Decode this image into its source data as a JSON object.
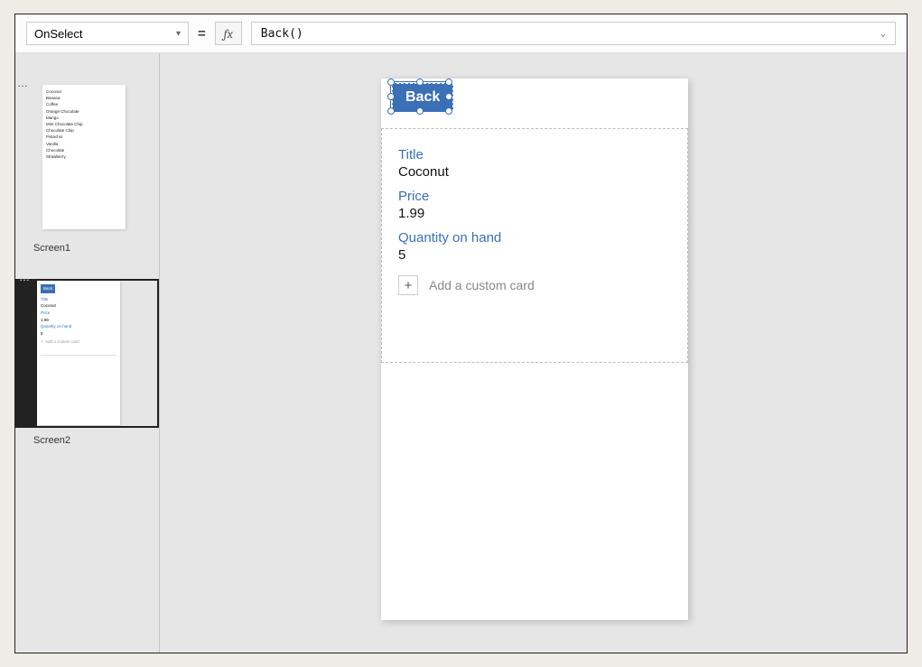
{
  "formula_bar": {
    "property": "OnSelect",
    "formula": "Back()"
  },
  "thumbs": {
    "screen1": {
      "label": "Screen1",
      "items": [
        "Coconut",
        "Banana",
        "Coffee",
        "Orange Chocolate",
        "Mango",
        "Mint Chocolate Chip",
        "Chocolate Chip",
        "Pistachio",
        "Vanilla",
        "Chocolate",
        "Strawberry"
      ]
    },
    "screen2": {
      "label": "Screen2",
      "back": "Back",
      "fields": {
        "title_label": "Title",
        "title_value": "Coconut",
        "price_label": "Price",
        "price_value": "1.99",
        "qty_label": "Quantity on hand",
        "qty_value": "5",
        "add": "Add a custom card"
      }
    }
  },
  "canvas": {
    "back_label": "Back",
    "fields": {
      "title_label": "Title",
      "title_value": "Coconut",
      "price_label": "Price",
      "price_value": "1.99",
      "qty_label": "Quantity on hand",
      "qty_value": "5"
    },
    "add_card": "Add a custom card"
  }
}
